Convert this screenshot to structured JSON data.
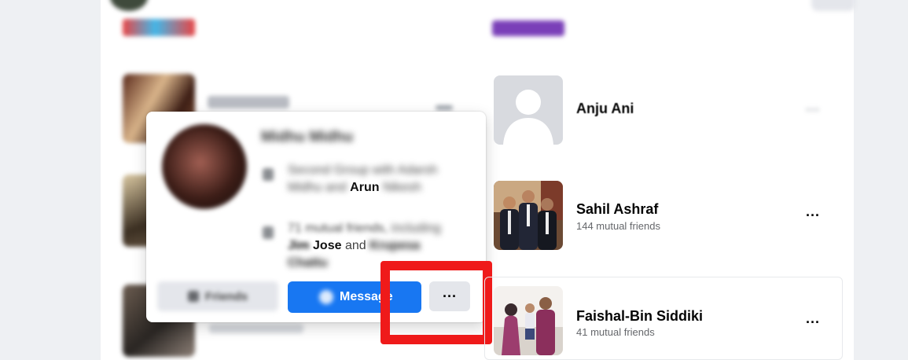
{
  "hover_card": {
    "name": "Midhu Midhu",
    "line1_prefix": "Second Group with",
    "line1_mid": "Adarsh Midhu and",
    "line1_bold": "Arun",
    "line1_bold2": "Nikesh",
    "line2_prefix": "71 mutual friends,",
    "line2_mid": "including",
    "line2_bold": "Jim",
    "line2_bold_b": "Jose",
    "line2_and": "and",
    "line2_bold2": "Krupesa Chattu",
    "follow_label": "Friends",
    "message_label": "Message",
    "more_label": "···"
  },
  "friends": [
    {
      "name": "Anju Ani",
      "mutual": "",
      "more_label": "···"
    },
    {
      "name": "Sahil Ashraf",
      "mutual": "144 mutual friends",
      "more_label": "···"
    },
    {
      "name": "Faishal-Bin Siddiki",
      "mutual": "41 mutual friends",
      "more_label": "···"
    }
  ],
  "colors": {
    "primary_blue": "#1877f2",
    "highlight_red": "#ef1a1a",
    "button_grey": "#e4e6eb"
  }
}
